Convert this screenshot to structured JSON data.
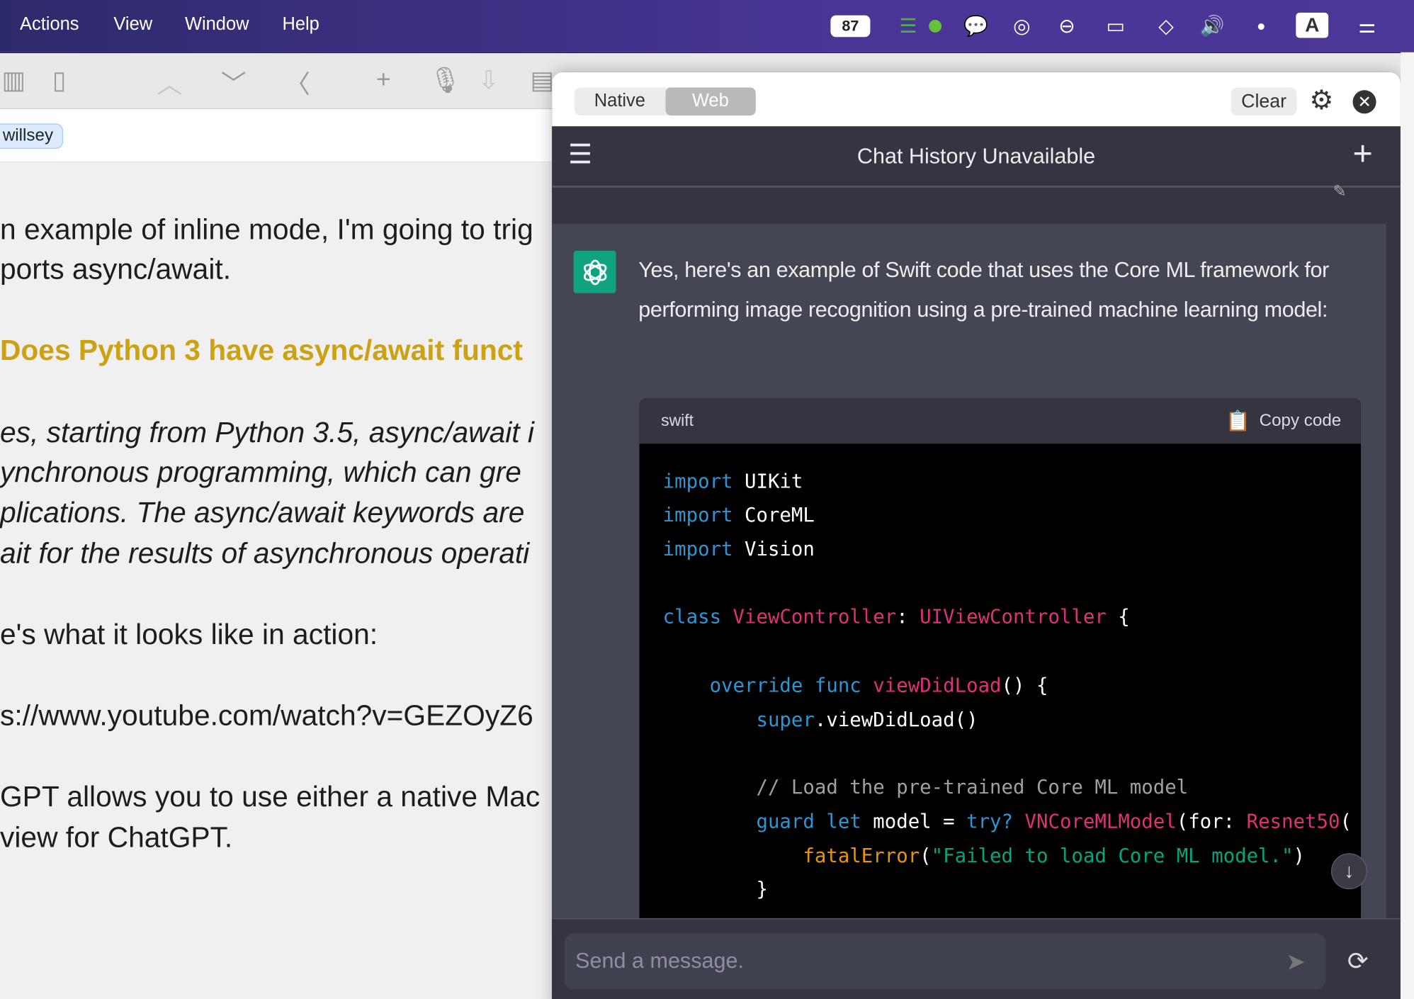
{
  "menubar": {
    "items": [
      "Actions",
      "View",
      "Window",
      "Help"
    ],
    "battery": "87",
    "input_source": "A"
  },
  "editor": {
    "tag": "willsey",
    "lines": [
      {
        "text": "n example of inline mode, I'm going to trig",
        "style": "normal"
      },
      {
        "text": "ports async/await.",
        "style": "normal"
      },
      {
        "text": "Does Python 3 have async/await funct",
        "style": "heading"
      },
      {
        "text": "es, starting from Python 3.5, async/await i",
        "style": "italic"
      },
      {
        "text": "ynchronous programming, which can gre",
        "style": "italic"
      },
      {
        "text": "plications. The async/await keywords are",
        "style": "italic"
      },
      {
        "text": "ait for the results of asynchronous operati",
        "style": "italic"
      },
      {
        "text": "e's what it looks like in action:",
        "style": "normal"
      },
      {
        "text": "s://www.youtube.com/watch?v=GEZOyZ6",
        "style": "normal"
      },
      {
        "text": "GPT allows you to use either a native Mac",
        "style": "normal"
      },
      {
        "text": "view for ChatGPT.",
        "style": "normal"
      }
    ]
  },
  "popover": {
    "modes": [
      "Native",
      "Web"
    ],
    "active_mode": "Web",
    "clear_label": "Clear",
    "title": "Chat History Unavailable",
    "message": "Yes, here's an example of Swift code that uses the Core ML framework for performing image recognition using a pre-trained machine learning model:",
    "code": {
      "language": "swift",
      "copy_label": "Copy code",
      "lines": [
        [
          {
            "t": "import ",
            "c": "kw"
          },
          {
            "t": "UIKit",
            "c": "pl"
          }
        ],
        [
          {
            "t": "import ",
            "c": "kw"
          },
          {
            "t": "CoreML",
            "c": "pl"
          }
        ],
        [
          {
            "t": "import ",
            "c": "kw"
          },
          {
            "t": "Vision",
            "c": "pl"
          }
        ],
        [],
        [
          {
            "t": "class ",
            "c": "kw"
          },
          {
            "t": "ViewController",
            "c": "ty"
          },
          {
            "t": ": ",
            "c": "pl"
          },
          {
            "t": "UIViewController",
            "c": "ty"
          },
          {
            "t": " {",
            "c": "pl"
          }
        ],
        [],
        [
          {
            "t": "    override ",
            "c": "kw"
          },
          {
            "t": "func ",
            "c": "kw"
          },
          {
            "t": "viewDidLoad",
            "c": "ty"
          },
          {
            "t": "() {",
            "c": "pl"
          }
        ],
        [
          {
            "t": "        super",
            "c": "kw"
          },
          {
            "t": ".viewDidLoad()",
            "c": "pl"
          }
        ],
        [],
        [
          {
            "t": "        // Load the pre-trained Core ML model",
            "c": "cm"
          }
        ],
        [
          {
            "t": "        guard ",
            "c": "kw"
          },
          {
            "t": "let ",
            "c": "kw"
          },
          {
            "t": "model = ",
            "c": "pl"
          },
          {
            "t": "try? ",
            "c": "kw"
          },
          {
            "t": "VNCoreMLModel",
            "c": "ty"
          },
          {
            "t": "(for: ",
            "c": "pl"
          },
          {
            "t": "Resnet50",
            "c": "ty"
          },
          {
            "t": "(",
            "c": "pl"
          }
        ],
        [
          {
            "t": "            fatalError",
            "c": "fn"
          },
          {
            "t": "(",
            "c": "pl"
          },
          {
            "t": "\"Failed to load Core ML model.\"",
            "c": "st"
          },
          {
            "t": ")",
            "c": "pl"
          }
        ],
        [
          {
            "t": "        }",
            "c": "pl"
          }
        ]
      ]
    },
    "input_placeholder": "Send a message."
  },
  "colors": {
    "kw": "#2e95d3",
    "ty": "#df3079",
    "pl": "#ffffff",
    "cm": "#a0a0a0",
    "fn": "#e9950c",
    "st": "#00a67d",
    "accent": "#10a37f"
  }
}
